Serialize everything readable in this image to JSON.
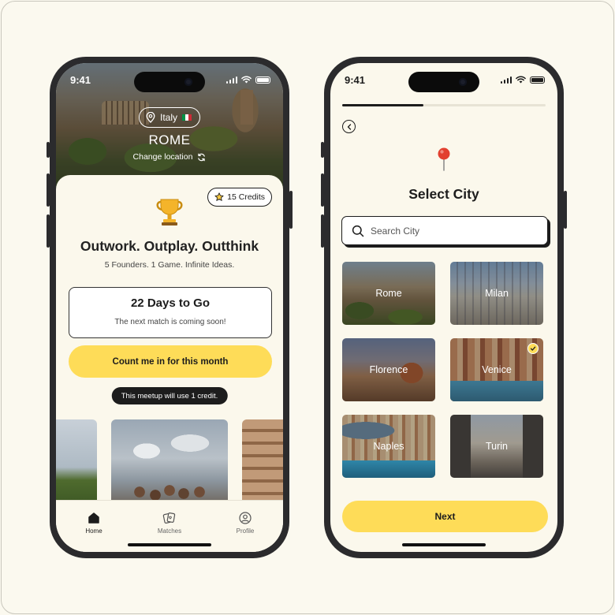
{
  "status_bar": {
    "time": "9:41"
  },
  "home_screen": {
    "location": {
      "country": "Italy",
      "flag_colors": [
        "#009246",
        "#ffffff",
        "#ce2b37"
      ],
      "city": "ROME",
      "change_label": "Change location"
    },
    "credits_label": "15 Credits",
    "headline": "Outwork. Outplay. Outthink",
    "subheadline": "5 Founders. 1 Game. Infinite Ideas.",
    "countdown": {
      "title": "22 Days to Go",
      "message": "The next match is coming soon!"
    },
    "cta_label": "Count me in for this month",
    "credit_note": "This meetup will use 1 credit.",
    "tabs": [
      {
        "label": "Home",
        "icon": "home-icon",
        "active": true
      },
      {
        "label": "Matches",
        "icon": "matches-icon",
        "active": false
      },
      {
        "label": "Profile",
        "icon": "profile-icon",
        "active": false
      }
    ]
  },
  "select_city_screen": {
    "progress_fraction": 0.4,
    "title": "Select City",
    "search": {
      "placeholder": "Search City",
      "value": ""
    },
    "cities": [
      {
        "name": "Rome",
        "selected": false
      },
      {
        "name": "Milan",
        "selected": false
      },
      {
        "name": "Florence",
        "selected": false
      },
      {
        "name": "Venice",
        "selected": true
      },
      {
        "name": "Naples",
        "selected": false
      },
      {
        "name": "Turin",
        "selected": false
      }
    ],
    "next_label": "Next"
  },
  "colors": {
    "background": "#fbf9ef",
    "accent_yellow": "#fedc58",
    "dark": "#1c1c1c",
    "phone_frame": "#2b2b2d"
  }
}
